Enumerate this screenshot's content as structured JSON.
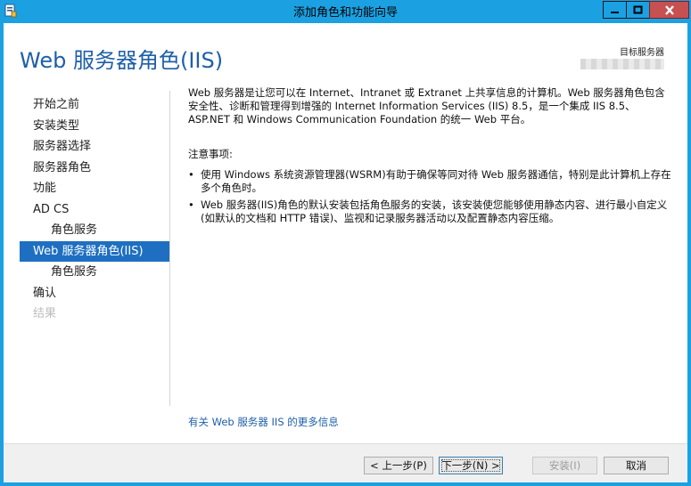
{
  "window": {
    "title": "添加角色和功能向导",
    "colors": {
      "titlebar": "#1ba1e2",
      "close": "#c75050",
      "accent": "#1e6fc1",
      "heading": "#1e5fa8"
    },
    "icons": {
      "app": "wizard-app-icon",
      "minimize": "minimize-icon",
      "maximize": "maximize-icon",
      "close": "close-icon"
    }
  },
  "header": {
    "title": "Web 服务器角色(IIS)",
    "target_label": "目标服务器"
  },
  "nav": {
    "items": [
      {
        "label": "开始之前",
        "level": 0,
        "state": "normal"
      },
      {
        "label": "安装类型",
        "level": 0,
        "state": "normal"
      },
      {
        "label": "服务器选择",
        "level": 0,
        "state": "normal"
      },
      {
        "label": "服务器角色",
        "level": 0,
        "state": "normal"
      },
      {
        "label": "功能",
        "level": 0,
        "state": "normal"
      },
      {
        "label": "AD CS",
        "level": 0,
        "state": "normal"
      },
      {
        "label": "角色服务",
        "level": 1,
        "state": "normal"
      },
      {
        "label": "Web 服务器角色(IIS)",
        "level": 0,
        "state": "selected"
      },
      {
        "label": "角色服务",
        "level": 1,
        "state": "normal"
      },
      {
        "label": "确认",
        "level": 0,
        "state": "normal"
      },
      {
        "label": "结果",
        "level": 0,
        "state": "disabled"
      }
    ]
  },
  "content": {
    "description": "Web 服务器是让您可以在 Internet、Intranet 或 Extranet 上共享信息的计算机。Web 服务器角色包含安全性、诊断和管理得到增强的 Internet Information Services (IIS) 8.5，是一个集成 IIS 8.5、ASP.NET 和 Windows Communication Foundation 的统一 Web 平台。",
    "notes_heading": "注意事项:",
    "bullet_symbol": "•",
    "notes": [
      "使用 Windows 系统资源管理器(WSRM)有助于确保等同对待 Web 服务器通信，特别是此计算机上存在多个角色时。",
      "Web 服务器(IIS)角色的默认安装包括角色服务的安装，该安装使您能够使用静态内容、进行最小自定义(如默认的文档和 HTTP 错误)、监视和记录服务器活动以及配置静态内容压缩。"
    ],
    "more_info_link": "有关 Web 服务器 IIS 的更多信息"
  },
  "footer": {
    "prev": "< 上一步(P)",
    "next": "下一步(N) >",
    "install": "安装(I)",
    "cancel": "取消"
  }
}
